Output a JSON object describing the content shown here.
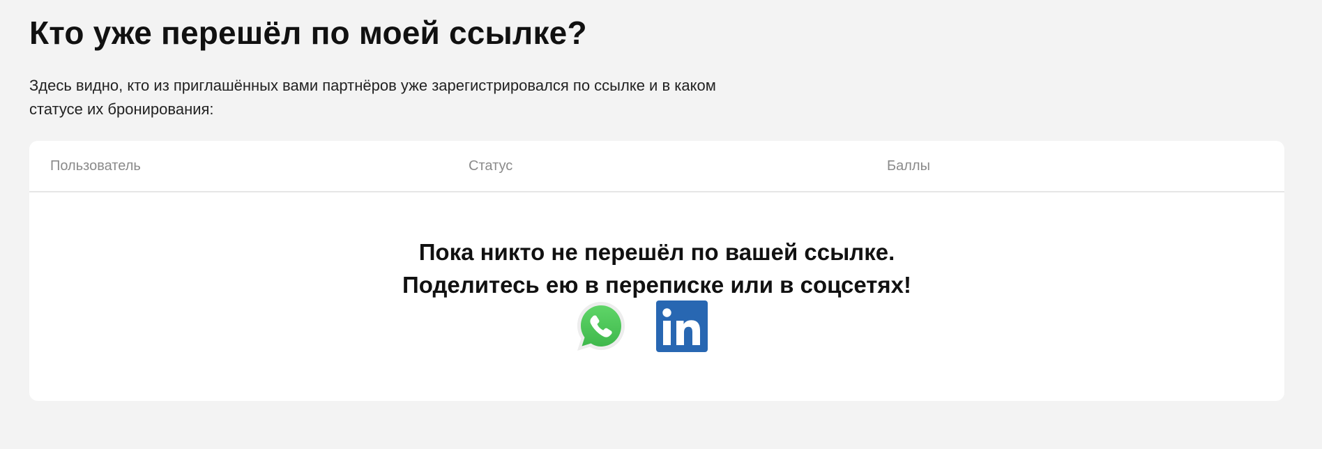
{
  "page": {
    "title": "Кто уже перешёл по моей ссылке?",
    "intro_line1": "Здесь видно, кто из приглашённых вами партнёров уже зарегистрировался по ссылке и в каком",
    "intro_line2": "статусе их бронирования:"
  },
  "table": {
    "columns": [
      "Пользователь",
      "Статус",
      "Баллы"
    ],
    "empty_line1": "Пока никто не перешёл по вашей ссылке.",
    "empty_line2": "Поделитесь ею в переписке или в соцсетях!"
  },
  "share": {
    "buttons": [
      {
        "icon": "whatsapp-icon",
        "color": "#4fce5d"
      },
      {
        "icon": "linkedin-icon",
        "color": "#2867b2"
      }
    ]
  }
}
